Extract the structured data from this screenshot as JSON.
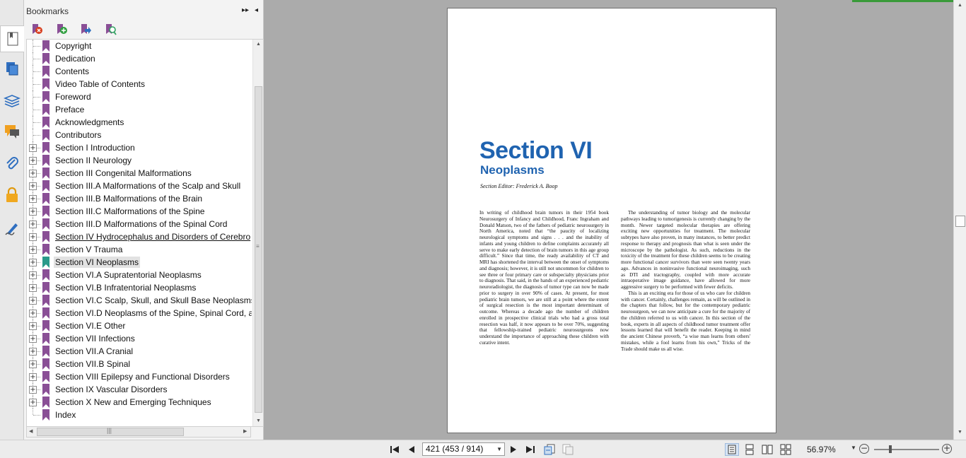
{
  "panel": {
    "title": "Bookmarks",
    "expand_glyph": "▸▸",
    "collapse_glyph": "◂"
  },
  "toolbar_icons": [
    "delete-bookmark-icon",
    "add-bookmark-icon",
    "go-to-bookmark-icon",
    "find-bookmark-icon"
  ],
  "bookmarks": [
    {
      "label": "Copyright",
      "expandable": false
    },
    {
      "label": "Dedication",
      "expandable": false
    },
    {
      "label": "Contents",
      "expandable": false
    },
    {
      "label": "Video Table of Contents",
      "expandable": false
    },
    {
      "label": "Foreword",
      "expandable": false
    },
    {
      "label": "Preface",
      "expandable": false
    },
    {
      "label": "Acknowledgments",
      "expandable": false
    },
    {
      "label": "Contributors",
      "expandable": false
    },
    {
      "label": "Section I Introduction",
      "expandable": true
    },
    {
      "label": "Section II Neurology",
      "expandable": true
    },
    {
      "label": "Section III Congenital Malformations",
      "expandable": true
    },
    {
      "label": "Section III.A Malformations of the Scalp and Skull",
      "expandable": true
    },
    {
      "label": "Section III.B Malformations of the Brain",
      "expandable": true
    },
    {
      "label": "Section III.C Malformations of the Spine",
      "expandable": true
    },
    {
      "label": "Section III.D Malformations of the Spinal Cord",
      "expandable": true
    },
    {
      "label": "Section IV Hydrocephalus and Disorders of Cerebro",
      "expandable": true,
      "underlined": true
    },
    {
      "label": "Section V Trauma",
      "expandable": true
    },
    {
      "label": "Section VI Neoplasms",
      "expandable": true,
      "selected": true
    },
    {
      "label": "Section VI.A Supratentorial Neoplasms",
      "expandable": true
    },
    {
      "label": "Section VI.B Infratentorial Neoplasms",
      "expandable": true
    },
    {
      "label": "Section VI.C Scalp, Skull, and Skull Base Neoplasms",
      "expandable": true
    },
    {
      "label": "Section VI.D Neoplasms of the Spine, Spinal Cord, a",
      "expandable": true
    },
    {
      "label": "Section VI.E Other",
      "expandable": true
    },
    {
      "label": "Section VII Infections",
      "expandable": true
    },
    {
      "label": "Section VII.A Cranial",
      "expandable": true
    },
    {
      "label": "Section VII.B Spinal",
      "expandable": true
    },
    {
      "label": "Section VIII Epilepsy and Functional Disorders",
      "expandable": true
    },
    {
      "label": "Section IX Vascular Disorders",
      "expandable": true
    },
    {
      "label": "Section X New and Emerging Techniques",
      "expandable": true
    },
    {
      "label": "Index",
      "expandable": false
    }
  ],
  "document": {
    "title": "Section VI",
    "subtitle": "Neoplasms",
    "editor_label": "Section Editor:",
    "editor_name": "Frederick A. Boop",
    "col_left": [
      "In writing of childhood brain tumors in their 1954 book Neurosurgery of Infancy and Childhood, Franc Ingraham and Donald Matson, two of the fathers of pediatric neurosurgery in North America, noted that “the paucity of localizing neurological symptoms and signs . . . and the inability of infants and young children to define complaints accurately all serve to make early detection of brain tumors in this age group difficult.” Since that time, the ready availability of CT and MRI has shortened the interval between the onset of symptoms and diagnosis; however, it is still not uncommon for children to see three or four primary care or subspecialty physicians prior to diagnosis. That said, in the hands of an experienced pediatric neuroradiologist, the diagnosis of tumor type can now be made prior to surgery in over 90% of cases. At present, for most pediatric brain tumors, we are still at a point where the extent of surgical resection is the most important determinant of outcome. Whereas a decade ago the number of children enrolled in prospective clinical trials who had a gross total resection was half, it now appears to be over 70%, suggesting that fellowship-trained pediatric neurosurgeons now understand the importance of approaching these children with curative intent."
    ],
    "col_right": [
      "The understanding of tumor biology and the molecular pathways leading to tumorigenesis is currently changing by the month. Newer targeted molecular therapies are offering exciting new opportunities for treatment. The molecular subtypes have also proven, in many instances, to better predict response to therapy and prognosis than what is seen under the microscope by the pathologist. As such, reductions in the toxicity of the treatment for these children seems to be creating more functional cancer survivors than were seen twenty years ago. Advances in noninvasive functional neuroimaging, such as DTI and tractography, coupled with more accurate intraoperative image guidance, have allowed for more aggressive surgery to be performed with fewer deficits.",
      "This is an exciting era for those of us who care for children with cancer. Certainly, challenges remain, as will be outlined in the chapters that follow, but for the contemporary pediatric neurosurgeon, we can now anticipate a cure for the majority of the children referred to us with cancer. In this section of the book, experts in all aspects of childhood tumor treatment offer lessons learned that will benefit the reader. Keeping in mind the ancient Chinese proverb, “a wise man learns from others' mistakes, while a fool learns from his own,” Tricks of the Trade should make us all wise."
    ]
  },
  "status": {
    "page_field": "421 (453 / 914)",
    "zoom": "56.97%",
    "zoom_fraction": 0.23
  },
  "colors": {
    "accent_blue": "#1f63b0",
    "bookmark_purple": "#8a4f96",
    "bookmark_teal": "#2a9a8a"
  }
}
